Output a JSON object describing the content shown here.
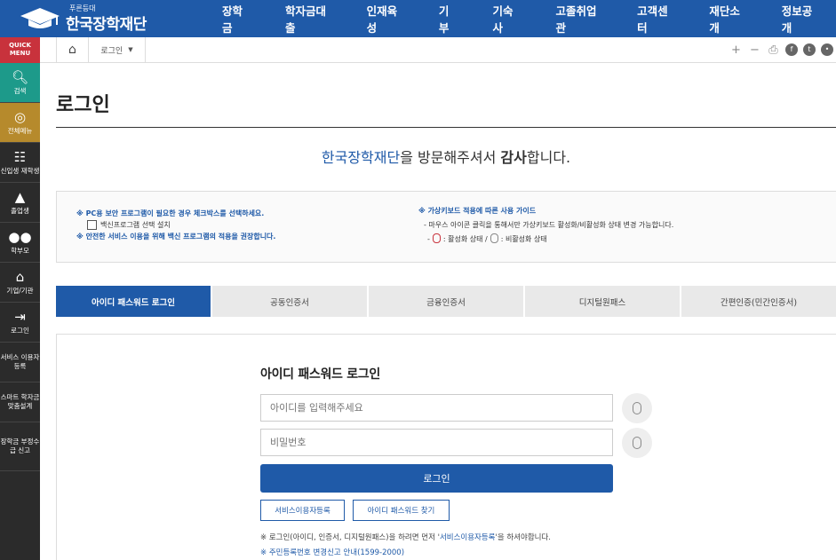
{
  "header": {
    "logo_small": "푸른등대",
    "logo_big": "한국장학재단",
    "nav": [
      "장학금",
      "학자금대출",
      "인재육성",
      "기부",
      "기숙사",
      "고졸취업관",
      "고객센터",
      "재단소개",
      "정보공개"
    ]
  },
  "sidebar": {
    "quick": "QUICK MENU",
    "items": [
      {
        "label": "검색"
      },
      {
        "label": "전체메뉴"
      },
      {
        "label": "신입생 재학생"
      },
      {
        "label": "졸업생"
      },
      {
        "label": "학부모"
      },
      {
        "label": "기업/기관"
      },
      {
        "label": "로그인"
      },
      {
        "label": "서비스 이용자 등록"
      },
      {
        "label": "스마트 학자금 맞춤설계"
      },
      {
        "label": "장학금 부정수급 신고"
      }
    ]
  },
  "breadcrumb": {
    "current": "로그인"
  },
  "page": {
    "title": "로그인",
    "welcome_hl": "한국장학재단",
    "welcome_mid": "을 방문해주셔서 ",
    "welcome_bold": "감사",
    "welcome_end": "합니다."
  },
  "notice": {
    "left1": "※ PC용 보안 프로그램이 필요한 경우 체크박스를 선택하세요.",
    "left_check": "백신프로그램 선택 설치",
    "left2": "※ 안전한 서비스 이용을 위해 백신 프로그램의 적용을 권장합니다.",
    "right1": "※ 가상키보드 적용에 따른 사용 가이드",
    "right2": "-  마우스 아이콘 클릭을 통해서만 가상키보드 활성화/비활성화 상태 변경 가능합니다.",
    "right3_a": ": 활성화 상태 /",
    "right3_b": ": 비활성화 상태"
  },
  "tabs": [
    "아이디 패스워드 로그인",
    "공동인증서",
    "금융인증서",
    "디지털원패스",
    "간편인증(민간인증서)"
  ],
  "login": {
    "heading": "아이디 패스워드 로그인",
    "id_placeholder": "아이디를 입력해주세요",
    "pw_placeholder": "비밀번호",
    "login_button": "로그인",
    "register_button": "서비스이용자등록",
    "find_button": "아이디 패스워드 찾기",
    "note_a": "※  로그인(아이디, 인증서, 디지털원패스)을 하려면 먼저 '",
    "note_link": "서비스이용자등록",
    "note_b": "'을 하셔야합니다.",
    "note2": "※ 주민등록번호 변경신고 안내(1599-2000)"
  }
}
